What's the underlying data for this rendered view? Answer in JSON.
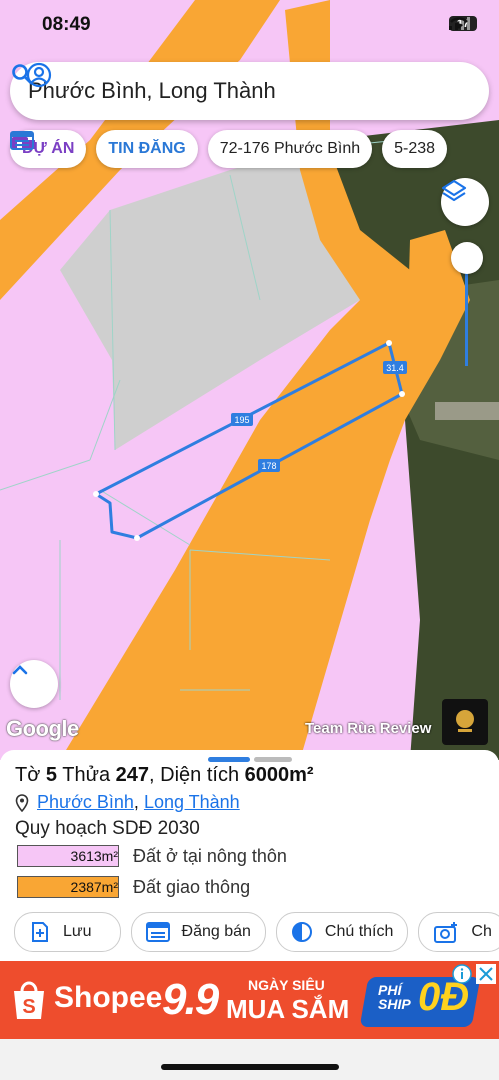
{
  "status": {
    "time": "08:49",
    "battery": "17"
  },
  "search": {
    "query": "Phước Bình, Long Thành"
  },
  "chips": [
    {
      "label": "DỰ ÁN"
    },
    {
      "label": "TIN ĐĂNG"
    },
    {
      "label": "72-176 Phước Bình"
    },
    {
      "label": "5-238"
    }
  ],
  "map": {
    "edge_labels": {
      "north": "195",
      "east": "31.4",
      "south": "178"
    },
    "brand": "Google",
    "watermark": "Team Rùa Review",
    "colors": {
      "residential": "#f6c6f6",
      "transport": "#f9a634",
      "parcel_line": "#2f7ee0",
      "gray_area": "#cfcfcf"
    }
  },
  "parcel": {
    "to_label": "Tờ",
    "to_value": "5",
    "thua_label": "Thửa",
    "thua_value": "247",
    "area_label": "Diện tích",
    "area_value": "6000m²",
    "ward": "Phước Bình",
    "separator": ",",
    "district": "Long Thành",
    "plan_title": "Quy hoạch SDĐ 2030"
  },
  "legend": [
    {
      "area": "3613m²",
      "label": "Đất ở tại nông thôn",
      "color": "#f6c6f6"
    },
    {
      "area": "2387m²",
      "label": "Đất giao thông",
      "color": "#f9a634"
    }
  ],
  "actions": [
    {
      "label": "Lưu",
      "icon": "add-box-icon"
    },
    {
      "label": "Đăng bán",
      "icon": "listing-icon"
    },
    {
      "label": "Chú thích",
      "icon": "contrast-icon"
    },
    {
      "label": "Ch",
      "icon": "add-photo-icon"
    }
  ],
  "ad": {
    "brand": "Shopee",
    "promo": "9.9",
    "line1": "NGÀY SIÊU",
    "line2": "MUA SẮM",
    "ship_text_1": "PHÍ",
    "ship_text_2": "SHIP",
    "ship_value": "0Đ",
    "colors": {
      "background": "#ee4d2d",
      "badge": "#1b5fc6"
    }
  }
}
